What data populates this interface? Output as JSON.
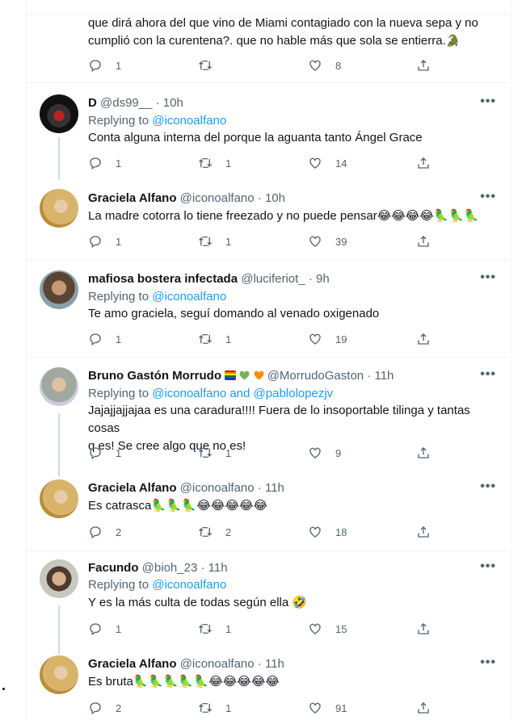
{
  "top_tweet": {
    "text_line1": "que dirá ahora del que vino de Miami contagiado con la nueva sepa  y no",
    "text_line2": "cumplió con la curentena?. que no hable más que sola se entierra.",
    "replies": "1",
    "retweets": "",
    "likes": "8"
  },
  "tweets": [
    {
      "name": "D",
      "handle": "@ds99__",
      "time": "· 10h",
      "replying_label": "Replying to",
      "replying_to": "@iconoalfano",
      "text": "Conta alguna interna del porque la aguanta tanto Ángel Grace",
      "replies": "1",
      "retweets": "1",
      "likes": "14"
    },
    {
      "name": "Graciela Alfano",
      "handle": "@iconoalfano",
      "time": "· 10h",
      "text": "La madre cotorra lo tiene freezado y no puede pensar😂😂😂😂🦜🦜🦜",
      "replies": "1",
      "retweets": "1",
      "likes": "39"
    },
    {
      "name": "mafiosa bostera infectada",
      "handle": "@luciferiot_",
      "time": "· 9h",
      "replying_label": "Replying to",
      "replying_to": "@iconoalfano",
      "text": "Te amo graciela, seguí domando al venado oxigenado",
      "replies": "1",
      "retweets": "1",
      "likes": "19"
    },
    {
      "name": "Bruno Gastón Morrudo",
      "handle": "@MorrudoGaston",
      "time": "· 11h",
      "replying_label": "Replying to",
      "replying_to": "@iconoalfano and @pablolopezjv",
      "text_line1": "Jajajjajjajaa es una caradura!!!! Fuera de lo insoportable tilinga y tantas cosas",
      "text_line2": "q es! Se cree algo que no es!",
      "replies": "1",
      "retweets": "1",
      "likes": "9"
    },
    {
      "name": "Graciela Alfano",
      "handle": "@iconoalfano",
      "time": "· 11h",
      "text": "Es catrasca🦜🦜🦜😂😂😂😂😂",
      "replies": "2",
      "retweets": "2",
      "likes": "18"
    },
    {
      "name": "Facundo",
      "handle": "@bioh_23",
      "time": "· 11h",
      "replying_label": "Replying to",
      "replying_to": "@iconoalfano",
      "text": "Y es la más culta de todas según ella 🤣",
      "replies": "1",
      "retweets": "1",
      "likes": "15"
    },
    {
      "name": "Graciela Alfano",
      "handle": "@iconoalfano",
      "time": "· 11h",
      "text": "Es bruta🦜🦜🦜🦜🦜😂😂😂😂😂",
      "replies": "2",
      "retweets": "1",
      "likes": "91"
    }
  ],
  "icons": [
    "reply-icon",
    "retweet-icon",
    "like-icon",
    "share-icon",
    "more-icon"
  ],
  "colors": {
    "link": "#1d9bf0",
    "secondary": "#536471",
    "thread_line": "#cfd9de"
  }
}
